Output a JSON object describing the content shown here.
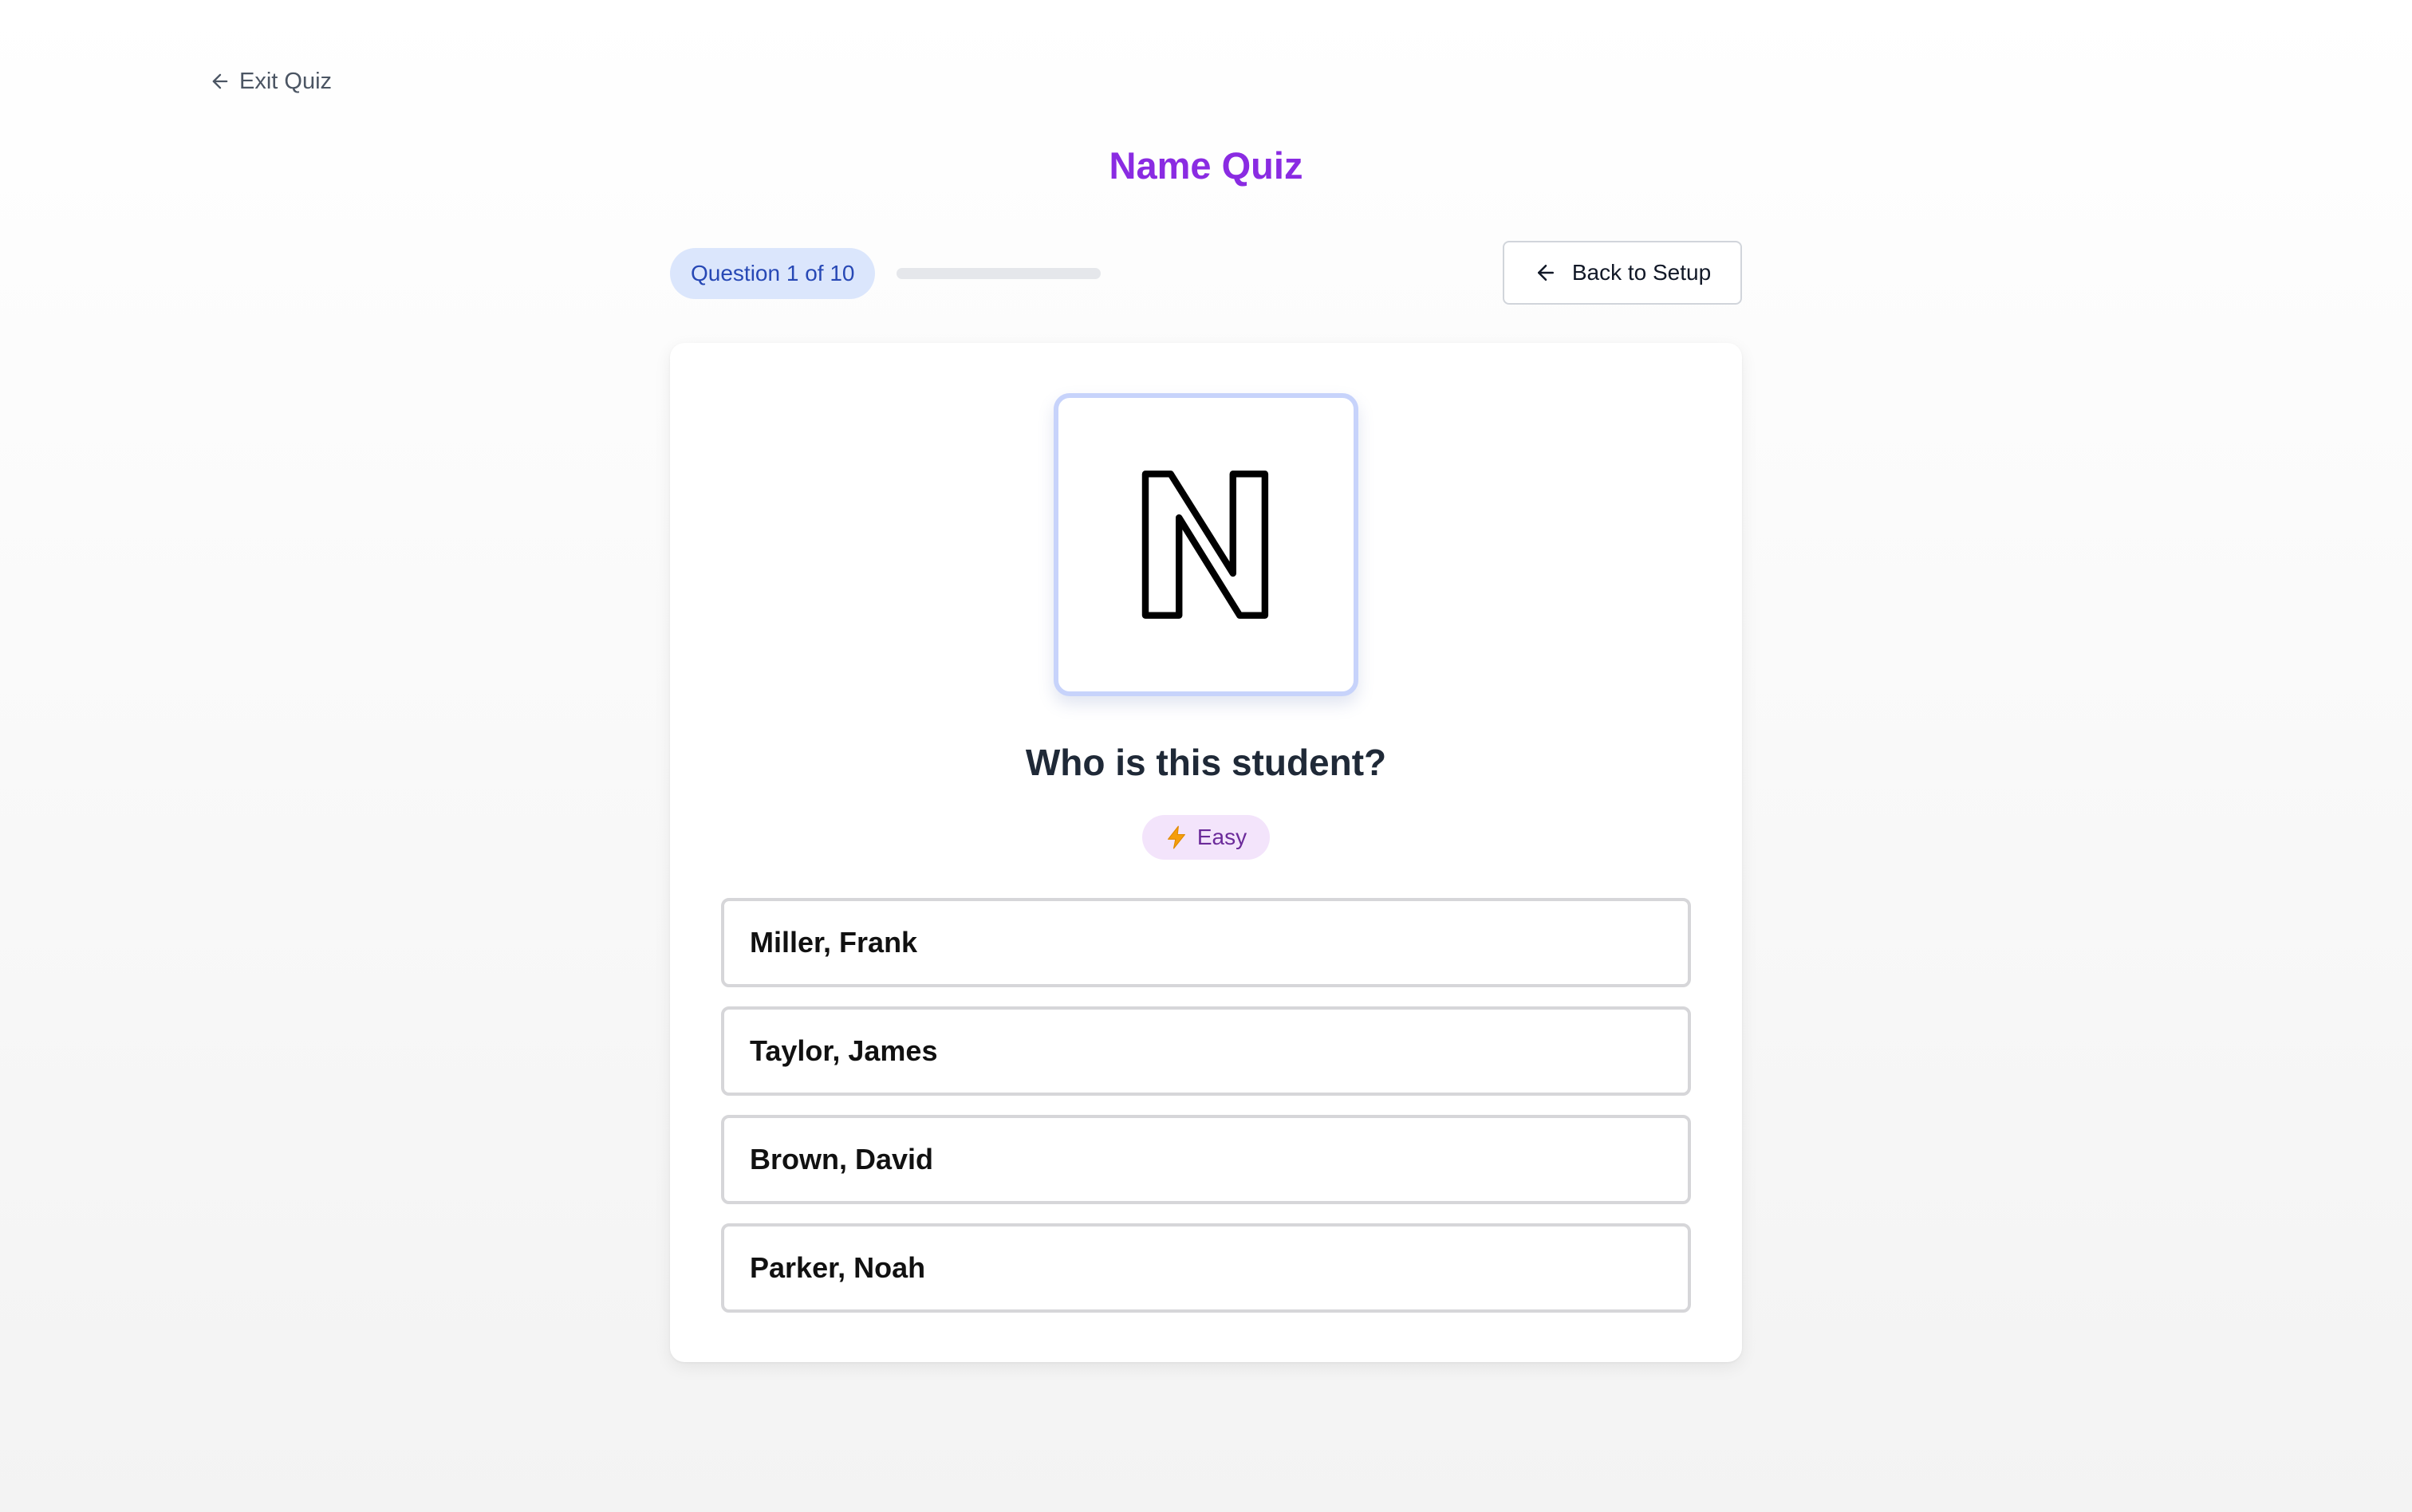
{
  "nav": {
    "exit_label": "Exit Quiz"
  },
  "header": {
    "title": "Name Quiz"
  },
  "progress": {
    "label": "Question 1 of 10",
    "current": 1,
    "total": 10,
    "fraction": 0.0
  },
  "toolbar": {
    "back_label": "Back to Setup"
  },
  "question": {
    "image_icon": "letter-n-outline-icon",
    "prompt": "Who is this student?",
    "difficulty_icon": "lightning-icon",
    "difficulty": "Easy"
  },
  "options": [
    {
      "label": "Miller, Frank"
    },
    {
      "label": "Taylor, James"
    },
    {
      "label": "Brown, David"
    },
    {
      "label": "Parker, Noah"
    }
  ],
  "colors": {
    "accent": "#8a2be2",
    "badge_bg": "#dbe6fc",
    "badge_text": "#2748b5",
    "difficulty_bg": "#f3e4fb",
    "lightning": "#f59e0b"
  }
}
